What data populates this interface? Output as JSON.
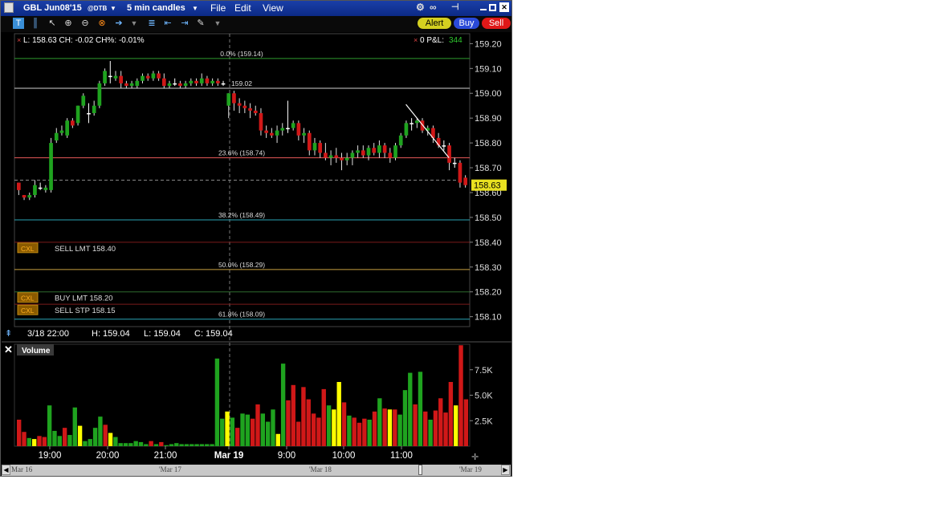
{
  "window": {
    "symbol": "GBL Jun08'15",
    "exchange": "@DTB",
    "interval": "5 min candles",
    "menu": [
      "File",
      "Edit",
      "View"
    ],
    "buttons": {
      "alert": "Alert",
      "buy": "Buy",
      "sell": "Sell"
    }
  },
  "colors": {
    "up": "#1fa31f",
    "down": "#d01818",
    "neutral": "#ffff00",
    "price_tag": "#e8e020",
    "fib": "#2e8b2e",
    "level_red": "#8a1a1a"
  },
  "info": {
    "quote": "L: 158.63 CH: -0.02 CH%: -0.01%",
    "pnl_label": "0 P&L:",
    "pnl_value": "344",
    "ohlc_date": "3/18 22:00",
    "ohlc_high": "H: 159.04",
    "ohlc_low": "L: 159.04",
    "ohlc_close": "C: 159.04",
    "last_price": "158.63"
  },
  "levels": [
    {
      "price": 159.14,
      "label": "0.0% (159.14)",
      "color": "#2e9b2e"
    },
    {
      "price": 159.02,
      "label": "159.02",
      "color": "#cfcfcf"
    },
    {
      "price": 158.74,
      "label": "23.6% (158.74)",
      "color": "#e85a5a"
    },
    {
      "price": 158.49,
      "label": "38.2% (158.49)",
      "color": "#2aa4b4"
    },
    {
      "price": 158.4,
      "label": "",
      "color": "#7a1a1a"
    },
    {
      "price": 158.29,
      "label": "50.0% (158.29)",
      "color": "#c8a040"
    },
    {
      "price": 158.2,
      "label": "",
      "color": "#2e6b2e"
    },
    {
      "price": 158.15,
      "label": "",
      "color": "#7a1a1a"
    },
    {
      "price": 158.09,
      "label": "61.8% (158.09)",
      "color": "#2aa4b4"
    }
  ],
  "orders": [
    {
      "tag": "CXL",
      "label": "SELL LMT 158.40",
      "price": 158.4
    },
    {
      "tag": "CXL",
      "label": "BUY LMT 158.20",
      "price": 158.2
    },
    {
      "tag": "CXL",
      "label": "SELL STP 158.15",
      "price": 158.15
    }
  ],
  "volume_panel": {
    "title": "Volume"
  },
  "scrollbar": {
    "labels": [
      "Mar 16",
      "'Mar 17",
      "'Mar 18",
      "'Mar 19"
    ]
  },
  "chart_data": {
    "type": "candlestick",
    "ylim": [
      158.06,
      159.24
    ],
    "yticks": [
      "159.20",
      "159.10",
      "159.00",
      "158.90",
      "158.80",
      "158.70",
      "158.60",
      "158.50",
      "158.40",
      "158.30",
      "158.20",
      "158.10"
    ],
    "xticks": [
      "19:00",
      "20:00",
      "21:00",
      "Mar 19",
      "9:00",
      "10:00",
      "11:00"
    ],
    "volume_ticks": [
      "7.5K",
      "5.0K",
      "2.5K"
    ],
    "volume_max": 10000,
    "candles": [
      {
        "o": 158.64,
        "h": 158.64,
        "l": 158.59,
        "c": 158.61
      },
      {
        "o": 158.59,
        "h": 158.59,
        "l": 158.57,
        "c": 158.58
      },
      {
        "o": 158.58,
        "h": 158.6,
        "l": 158.57,
        "c": 158.59
      },
      {
        "o": 158.59,
        "h": 158.65,
        "l": 158.58,
        "c": 158.63
      },
      {
        "o": 158.62,
        "h": 158.64,
        "l": 158.61,
        "c": 158.62
      },
      {
        "o": 158.61,
        "h": 158.63,
        "l": 158.6,
        "c": 158.62
      },
      {
        "o": 158.61,
        "h": 158.82,
        "l": 158.6,
        "c": 158.8
      },
      {
        "o": 158.81,
        "h": 158.86,
        "l": 158.8,
        "c": 158.84
      },
      {
        "o": 158.84,
        "h": 158.87,
        "l": 158.83,
        "c": 158.85
      },
      {
        "o": 158.83,
        "h": 158.9,
        "l": 158.82,
        "c": 158.89
      },
      {
        "o": 158.89,
        "h": 158.9,
        "l": 158.86,
        "c": 158.87
      },
      {
        "o": 158.88,
        "h": 158.95,
        "l": 158.87,
        "c": 158.95
      },
      {
        "o": 158.95,
        "h": 159.0,
        "l": 158.94,
        "c": 158.99
      },
      {
        "o": 158.92,
        "h": 158.96,
        "l": 158.88,
        "c": 158.92
      },
      {
        "o": 158.92,
        "h": 158.97,
        "l": 158.91,
        "c": 158.95
      },
      {
        "o": 158.95,
        "h": 159.05,
        "l": 158.94,
        "c": 159.04
      },
      {
        "o": 159.04,
        "h": 159.1,
        "l": 159.03,
        "c": 159.09
      },
      {
        "o": 159.07,
        "h": 159.13,
        "l": 159.04,
        "c": 159.07
      },
      {
        "o": 159.06,
        "h": 159.09,
        "l": 159.05,
        "c": 159.07
      },
      {
        "o": 159.07,
        "h": 159.09,
        "l": 159.02,
        "c": 159.04
      },
      {
        "o": 159.04,
        "h": 159.05,
        "l": 159.02,
        "c": 159.03
      },
      {
        "o": 159.03,
        "h": 159.05,
        "l": 159.02,
        "c": 159.04
      },
      {
        "o": 159.03,
        "h": 159.06,
        "l": 159.02,
        "c": 159.05
      },
      {
        "o": 159.05,
        "h": 159.08,
        "l": 159.04,
        "c": 159.07
      },
      {
        "o": 159.07,
        "h": 159.08,
        "l": 159.05,
        "c": 159.06
      },
      {
        "o": 159.06,
        "h": 159.09,
        "l": 159.05,
        "c": 159.08
      },
      {
        "o": 159.08,
        "h": 159.09,
        "l": 159.05,
        "c": 159.06
      },
      {
        "o": 159.06,
        "h": 159.08,
        "l": 159.02,
        "c": 159.03
      },
      {
        "o": 159.03,
        "h": 159.05,
        "l": 159.02,
        "c": 159.04
      },
      {
        "o": 159.04,
        "h": 159.06,
        "l": 159.03,
        "c": 159.04
      },
      {
        "o": 159.04,
        "h": 159.05,
        "l": 159.02,
        "c": 159.03
      },
      {
        "o": 159.03,
        "h": 159.05,
        "l": 159.02,
        "c": 159.04
      },
      {
        "o": 159.04,
        "h": 159.06,
        "l": 159.03,
        "c": 159.05
      },
      {
        "o": 159.05,
        "h": 159.06,
        "l": 159.03,
        "c": 159.04
      },
      {
        "o": 159.04,
        "h": 159.08,
        "l": 159.03,
        "c": 159.06
      },
      {
        "o": 159.06,
        "h": 159.07,
        "l": 159.03,
        "c": 159.04
      },
      {
        "o": 159.04,
        "h": 159.06,
        "l": 159.03,
        "c": 159.05
      },
      {
        "o": 159.05,
        "h": 159.06,
        "l": 159.03,
        "c": 159.04
      },
      {
        "o": 159.04,
        "h": 159.05,
        "l": 159.03,
        "c": 159.04
      },
      {
        "o": 158.95,
        "h": 159.0,
        "l": 158.9,
        "c": 159.0
      },
      {
        "o": 159.0,
        "h": 159.01,
        "l": 158.93,
        "c": 158.96
      },
      {
        "o": 158.96,
        "h": 158.98,
        "l": 158.92,
        "c": 158.95
      },
      {
        "o": 158.95,
        "h": 158.97,
        "l": 158.92,
        "c": 158.94
      },
      {
        "o": 158.94,
        "h": 158.96,
        "l": 158.9,
        "c": 158.93
      },
      {
        "o": 158.93,
        "h": 158.95,
        "l": 158.91,
        "c": 158.92
      },
      {
        "o": 158.92,
        "h": 158.94,
        "l": 158.83,
        "c": 158.85
      },
      {
        "o": 158.85,
        "h": 158.87,
        "l": 158.82,
        "c": 158.84
      },
      {
        "o": 158.84,
        "h": 158.86,
        "l": 158.82,
        "c": 158.83
      },
      {
        "o": 158.83,
        "h": 158.87,
        "l": 158.8,
        "c": 158.85
      },
      {
        "o": 158.85,
        "h": 158.88,
        "l": 158.83,
        "c": 158.86
      },
      {
        "o": 158.86,
        "h": 158.97,
        "l": 158.84,
        "c": 158.86
      },
      {
        "o": 158.86,
        "h": 158.89,
        "l": 158.85,
        "c": 158.88
      },
      {
        "o": 158.88,
        "h": 158.89,
        "l": 158.81,
        "c": 158.83
      },
      {
        "o": 158.83,
        "h": 158.86,
        "l": 158.8,
        "c": 158.84
      },
      {
        "o": 158.84,
        "h": 158.85,
        "l": 158.75,
        "c": 158.77
      },
      {
        "o": 158.77,
        "h": 158.82,
        "l": 158.75,
        "c": 158.8
      },
      {
        "o": 158.8,
        "h": 158.81,
        "l": 158.74,
        "c": 158.76
      },
      {
        "o": 158.76,
        "h": 158.8,
        "l": 158.73,
        "c": 158.74
      },
      {
        "o": 158.74,
        "h": 158.77,
        "l": 158.71,
        "c": 158.75
      },
      {
        "o": 158.75,
        "h": 158.78,
        "l": 158.72,
        "c": 158.74
      },
      {
        "o": 158.74,
        "h": 158.76,
        "l": 158.69,
        "c": 158.73
      },
      {
        "o": 158.73,
        "h": 158.76,
        "l": 158.71,
        "c": 158.74
      },
      {
        "o": 158.74,
        "h": 158.77,
        "l": 158.71,
        "c": 158.76
      },
      {
        "o": 158.76,
        "h": 158.79,
        "l": 158.74,
        "c": 158.77
      },
      {
        "o": 158.77,
        "h": 158.79,
        "l": 158.74,
        "c": 158.75
      },
      {
        "o": 158.75,
        "h": 158.79,
        "l": 158.73,
        "c": 158.78
      },
      {
        "o": 158.78,
        "h": 158.8,
        "l": 158.75,
        "c": 158.76
      },
      {
        "o": 158.76,
        "h": 158.81,
        "l": 158.74,
        "c": 158.79
      },
      {
        "o": 158.79,
        "h": 158.8,
        "l": 158.74,
        "c": 158.76
      },
      {
        "o": 158.76,
        "h": 158.78,
        "l": 158.72,
        "c": 158.74
      },
      {
        "o": 158.74,
        "h": 158.8,
        "l": 158.73,
        "c": 158.79
      },
      {
        "o": 158.79,
        "h": 158.84,
        "l": 158.78,
        "c": 158.83
      },
      {
        "o": 158.83,
        "h": 158.89,
        "l": 158.82,
        "c": 158.88
      },
      {
        "o": 158.88,
        "h": 158.9,
        "l": 158.85,
        "c": 158.88
      },
      {
        "o": 158.88,
        "h": 158.9,
        "l": 158.86,
        "c": 158.89
      },
      {
        "o": 158.89,
        "h": 158.9,
        "l": 158.84,
        "c": 158.85
      },
      {
        "o": 158.85,
        "h": 158.87,
        "l": 158.83,
        "c": 158.86
      },
      {
        "o": 158.86,
        "h": 158.87,
        "l": 158.8,
        "c": 158.82
      },
      {
        "o": 158.82,
        "h": 158.84,
        "l": 158.78,
        "c": 158.79
      },
      {
        "o": 158.79,
        "h": 158.81,
        "l": 158.77,
        "c": 158.79
      },
      {
        "o": 158.79,
        "h": 158.8,
        "l": 158.69,
        "c": 158.72
      },
      {
        "o": 158.72,
        "h": 158.74,
        "l": 158.7,
        "c": 158.72
      },
      {
        "o": 158.72,
        "h": 158.73,
        "l": 158.62,
        "c": 158.64
      },
      {
        "o": 158.66,
        "h": 158.67,
        "l": 158.62,
        "c": 158.63
      }
    ],
    "volumes": [
      {
        "v": 2600,
        "c": "r"
      },
      {
        "v": 1400,
        "c": "r"
      },
      {
        "v": 800,
        "c": "g"
      },
      {
        "v": 700,
        "c": "y"
      },
      {
        "v": 1000,
        "c": "r"
      },
      {
        "v": 900,
        "c": "r"
      },
      {
        "v": 4000,
        "c": "g"
      },
      {
        "v": 1500,
        "c": "g"
      },
      {
        "v": 1000,
        "c": "g"
      },
      {
        "v": 1800,
        "c": "r"
      },
      {
        "v": 1100,
        "c": "g"
      },
      {
        "v": 3800,
        "c": "g"
      },
      {
        "v": 2000,
        "c": "y"
      },
      {
        "v": 500,
        "c": "g"
      },
      {
        "v": 700,
        "c": "g"
      },
      {
        "v": 1800,
        "c": "g"
      },
      {
        "v": 2900,
        "c": "g"
      },
      {
        "v": 2100,
        "c": "r"
      },
      {
        "v": 1300,
        "c": "y"
      },
      {
        "v": 900,
        "c": "g"
      },
      {
        "v": 300,
        "c": "g"
      },
      {
        "v": 300,
        "c": "g"
      },
      {
        "v": 300,
        "c": "g"
      },
      {
        "v": 500,
        "c": "g"
      },
      {
        "v": 400,
        "c": "g"
      },
      {
        "v": 200,
        "c": "g"
      },
      {
        "v": 500,
        "c": "r"
      },
      {
        "v": 200,
        "c": "g"
      },
      {
        "v": 400,
        "c": "r"
      },
      {
        "v": 100,
        "c": "g"
      },
      {
        "v": 200,
        "c": "g"
      },
      {
        "v": 300,
        "c": "g"
      },
      {
        "v": 200,
        "c": "g"
      },
      {
        "v": 200,
        "c": "g"
      },
      {
        "v": 200,
        "c": "g"
      },
      {
        "v": 200,
        "c": "g"
      },
      {
        "v": 200,
        "c": "g"
      },
      {
        "v": 200,
        "c": "g"
      },
      {
        "v": 200,
        "c": "g"
      },
      {
        "v": 8600,
        "c": "g"
      },
      {
        "v": 2700,
        "c": "g"
      },
      {
        "v": 3400,
        "c": "y"
      },
      {
        "v": 2800,
        "c": "g"
      },
      {
        "v": 1800,
        "c": "r"
      },
      {
        "v": 3200,
        "c": "g"
      },
      {
        "v": 3100,
        "c": "g"
      },
      {
        "v": 2700,
        "c": "r"
      },
      {
        "v": 4100,
        "c": "r"
      },
      {
        "v": 3200,
        "c": "g"
      },
      {
        "v": 2400,
        "c": "g"
      },
      {
        "v": 3600,
        "c": "g"
      },
      {
        "v": 1200,
        "c": "y"
      },
      {
        "v": 8100,
        "c": "g"
      },
      {
        "v": 4500,
        "c": "r"
      },
      {
        "v": 6000,
        "c": "r"
      },
      {
        "v": 2400,
        "c": "r"
      },
      {
        "v": 5800,
        "c": "r"
      },
      {
        "v": 4600,
        "c": "r"
      },
      {
        "v": 3200,
        "c": "r"
      },
      {
        "v": 2800,
        "c": "r"
      },
      {
        "v": 5600,
        "c": "r"
      },
      {
        "v": 4000,
        "c": "g"
      },
      {
        "v": 3600,
        "c": "y"
      },
      {
        "v": 6300,
        "c": "y"
      },
      {
        "v": 4300,
        "c": "r"
      },
      {
        "v": 3000,
        "c": "g"
      },
      {
        "v": 2800,
        "c": "r"
      },
      {
        "v": 2300,
        "c": "r"
      },
      {
        "v": 2700,
        "c": "r"
      },
      {
        "v": 2600,
        "c": "g"
      },
      {
        "v": 3400,
        "c": "r"
      },
      {
        "v": 4700,
        "c": "g"
      },
      {
        "v": 3700,
        "c": "r"
      },
      {
        "v": 3600,
        "c": "y"
      },
      {
        "v": 3600,
        "c": "r"
      },
      {
        "v": 3100,
        "c": "g"
      },
      {
        "v": 5500,
        "c": "g"
      },
      {
        "v": 7200,
        "c": "g"
      },
      {
        "v": 4100,
        "c": "r"
      },
      {
        "v": 7300,
        "c": "g"
      },
      {
        "v": 3400,
        "c": "r"
      },
      {
        "v": 2600,
        "c": "g"
      },
      {
        "v": 3500,
        "c": "r"
      },
      {
        "v": 4700,
        "c": "r"
      },
      {
        "v": 3300,
        "c": "r"
      },
      {
        "v": 6300,
        "c": "r"
      },
      {
        "v": 4000,
        "c": "y"
      },
      {
        "v": 9900,
        "c": "r"
      },
      {
        "v": 4600,
        "c": "r"
      }
    ]
  }
}
